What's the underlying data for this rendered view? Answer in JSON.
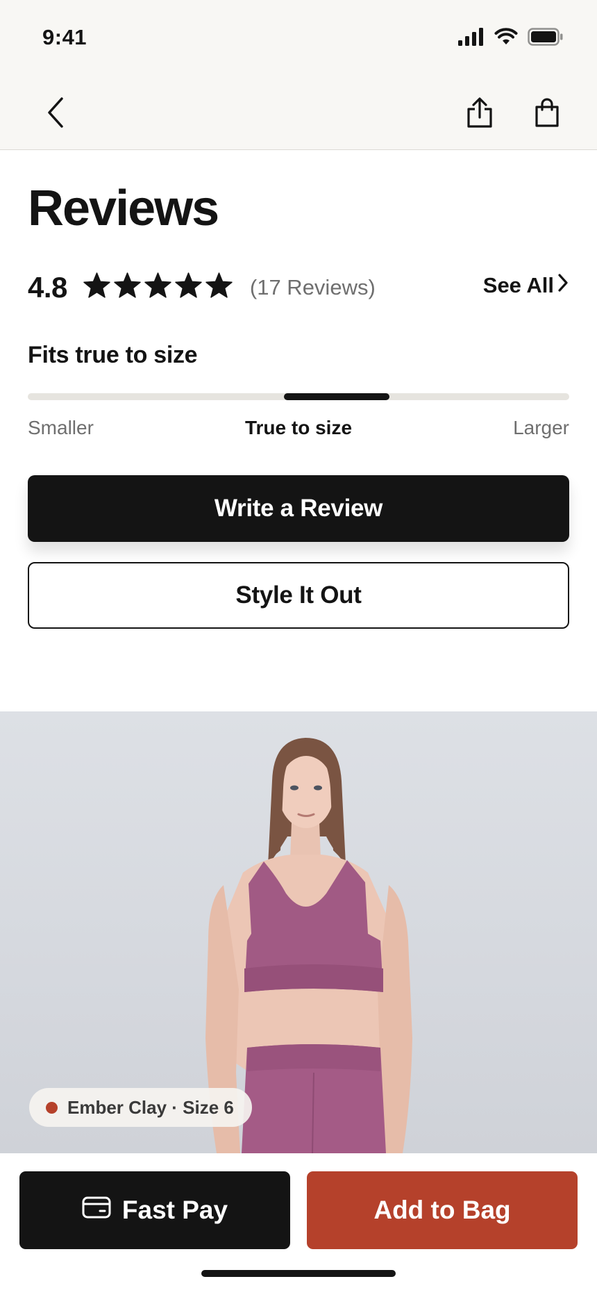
{
  "status_bar": {
    "time": "9:41",
    "icons": [
      "signal-icon",
      "wifi-icon",
      "battery-icon"
    ]
  },
  "nav": {
    "back_icon": "chevron-left-icon",
    "share_icon": "share-icon",
    "bag_icon": "shopping-bag-icon"
  },
  "reviews": {
    "title": "Reviews",
    "rating": "4.8",
    "stars_filled": 5,
    "stars_total": 5,
    "count_text": "(17 Reviews)",
    "see_all_label": "See All"
  },
  "fit": {
    "title": "Fits true to size",
    "position": 0.57,
    "labels": {
      "smaller": "Smaller",
      "true": "True to size",
      "larger": "Larger"
    }
  },
  "actions": {
    "write_review": "Write a Review",
    "style_it_out": "Style It Out"
  },
  "product": {
    "variant_text": "Ember Clay · Size 6",
    "variant_color": "#b5412b"
  },
  "bottom_bar": {
    "fast_pay": "Fast Pay",
    "fast_pay_icon": "credit-card-icon",
    "add_to_bag": "Add to Bag"
  },
  "colors": {
    "accent": "#b5412b",
    "primary": "#141414",
    "chrome_bg": "#f8f7f4"
  }
}
